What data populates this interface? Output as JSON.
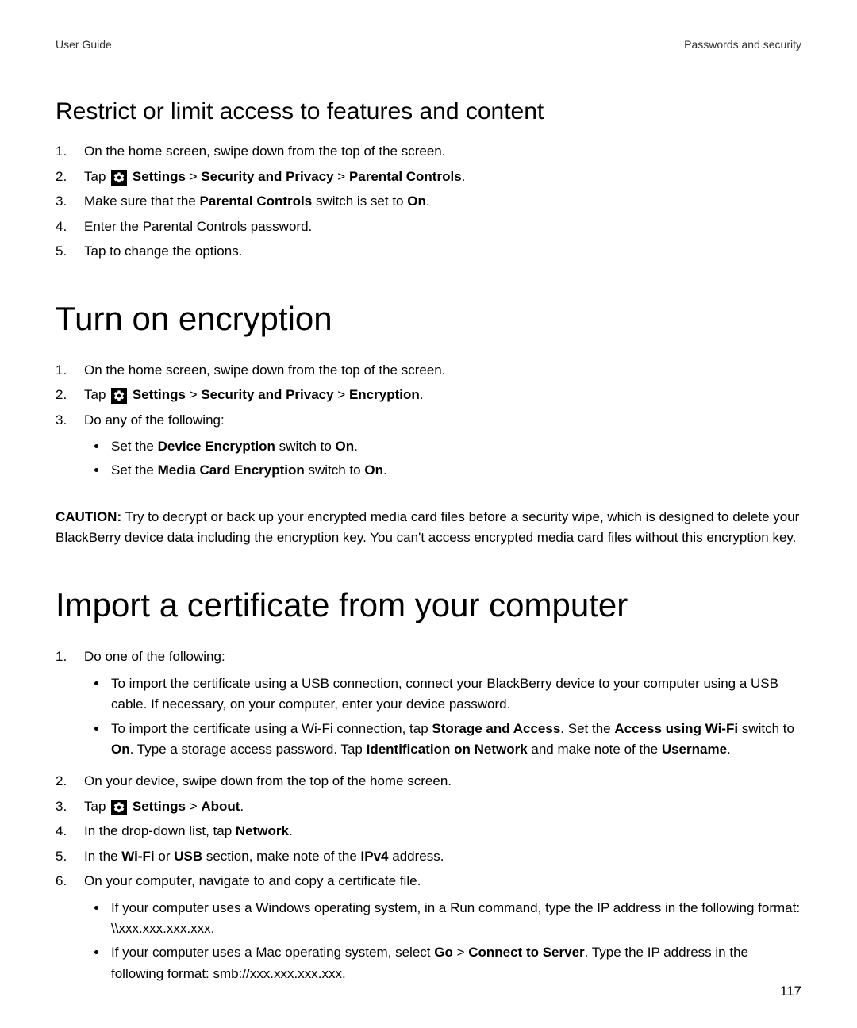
{
  "header": {
    "left": "User Guide",
    "right": "Passwords and security"
  },
  "section_restrict": {
    "title": "Restrict or limit access to features and content",
    "steps": {
      "s1": "On the home screen, swipe down from the top of the screen.",
      "s2_pre": "Tap ",
      "s2_settings": "Settings",
      "s2_sec": "Security and Privacy",
      "s2_pc": "Parental Controls",
      "s3_pre": "Make sure that the ",
      "s3_pc": "Parental Controls",
      "s3_mid": " switch is set to ",
      "s3_on": "On",
      "s4": "Enter the Parental Controls password.",
      "s5": "Tap to change the options."
    }
  },
  "section_encrypt": {
    "title": "Turn on encryption",
    "steps": {
      "s1": "On the home screen, swipe down from the top of the screen.",
      "s2_pre": "Tap ",
      "s2_settings": "Settings",
      "s2_sec": "Security and Privacy",
      "s2_enc": "Encryption",
      "s3": "Do any of the following:",
      "b1_pre": "Set the ",
      "b1_de": "Device Encryption",
      "b1_mid": " switch to ",
      "b1_on": "On",
      "b2_pre": "Set the ",
      "b2_mce": "Media Card Encryption",
      "b2_mid": " switch to ",
      "b2_on": "On"
    },
    "caution_label": "CAUTION:",
    "caution_text": " Try to decrypt or back up your encrypted media card files before a security wipe, which is designed to delete your BlackBerry device data including the encryption key. You can't access encrypted media card files without this encryption key."
  },
  "section_import": {
    "title": "Import a certificate from your computer",
    "steps": {
      "s1": "Do one of the following:",
      "s1_b1": "To import the certificate using a USB connection, connect your BlackBerry device to your computer using a USB cable. If necessary, on your computer, enter your device password.",
      "s1_b2_a": "To import the certificate using a Wi-Fi connection, tap ",
      "s1_b2_sa": "Storage and Access",
      "s1_b2_b": ". Set the ",
      "s1_b2_aw": "Access using Wi-Fi",
      "s1_b2_c": " switch to ",
      "s1_b2_on": "On",
      "s1_b2_d": ". Type a storage access password. Tap ",
      "s1_b2_ion": "Identification on Network",
      "s1_b2_e": " and make note of the ",
      "s1_b2_un": "Username",
      "s2": "On your device, swipe down from the top of the home screen.",
      "s3_pre": "Tap ",
      "s3_settings": "Settings",
      "s3_about": "About",
      "s4_pre": "In the drop-down list, tap ",
      "s4_net": "Network",
      "s5_pre": "In the ",
      "s5_wifi": "Wi-Fi",
      "s5_or": " or ",
      "s5_usb": "USB",
      "s5_mid": " section, make note of the ",
      "s5_ipv4": "IPv4",
      "s5_post": " address.",
      "s6": "On your computer, navigate to and copy a certificate file.",
      "s6_b1": "If your computer uses a Windows operating system, in a Run command, type the IP address in the following format: \\\\xxx.xxx.xxx.xxx.",
      "s6_b2_a": "If your computer uses a Mac operating system, select ",
      "s6_b2_go": "Go",
      "s6_b2_gt": " > ",
      "s6_b2_cts": "Connect to Server",
      "s6_b2_b": ". Type the IP address in the following format: smb://xxx.xxx.xxx.xxx."
    }
  },
  "page_number": "117",
  "nums": {
    "n1": "1.",
    "n2": "2.",
    "n3": "3.",
    "n4": "4.",
    "n5": "5.",
    "n6": "6."
  },
  "sep": {
    "gt": " > ",
    "dot": "."
  }
}
